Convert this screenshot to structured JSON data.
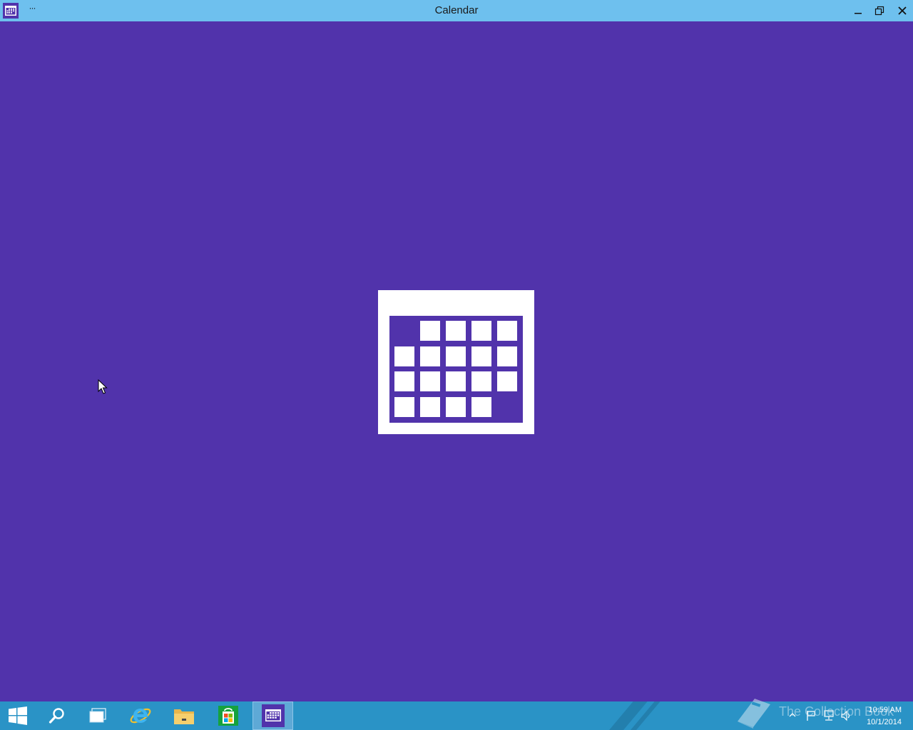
{
  "window": {
    "title": "Calendar",
    "menu_label": "···"
  },
  "colors": {
    "app_background": "#5133ab",
    "titlebar": "#6ec0ee",
    "taskbar": "#2a93c6",
    "taskbar_active": "#5ea9d6"
  },
  "taskbar": {
    "items": [
      {
        "icon": "windows-logo-icon"
      },
      {
        "icon": "search-icon"
      },
      {
        "icon": "task-view-icon"
      },
      {
        "icon": "internet-explorer-icon"
      },
      {
        "icon": "file-explorer-icon"
      },
      {
        "icon": "store-icon"
      },
      {
        "icon": "calendar-icon",
        "active": true
      }
    ],
    "tray_icons": [
      "show-hidden-icon",
      "flag-icon",
      "network-icon",
      "volume-icon"
    ],
    "clock": {
      "time": "10:59 AM",
      "date": "10/1/2014"
    }
  },
  "watermark": {
    "text": "The Collection Book"
  }
}
